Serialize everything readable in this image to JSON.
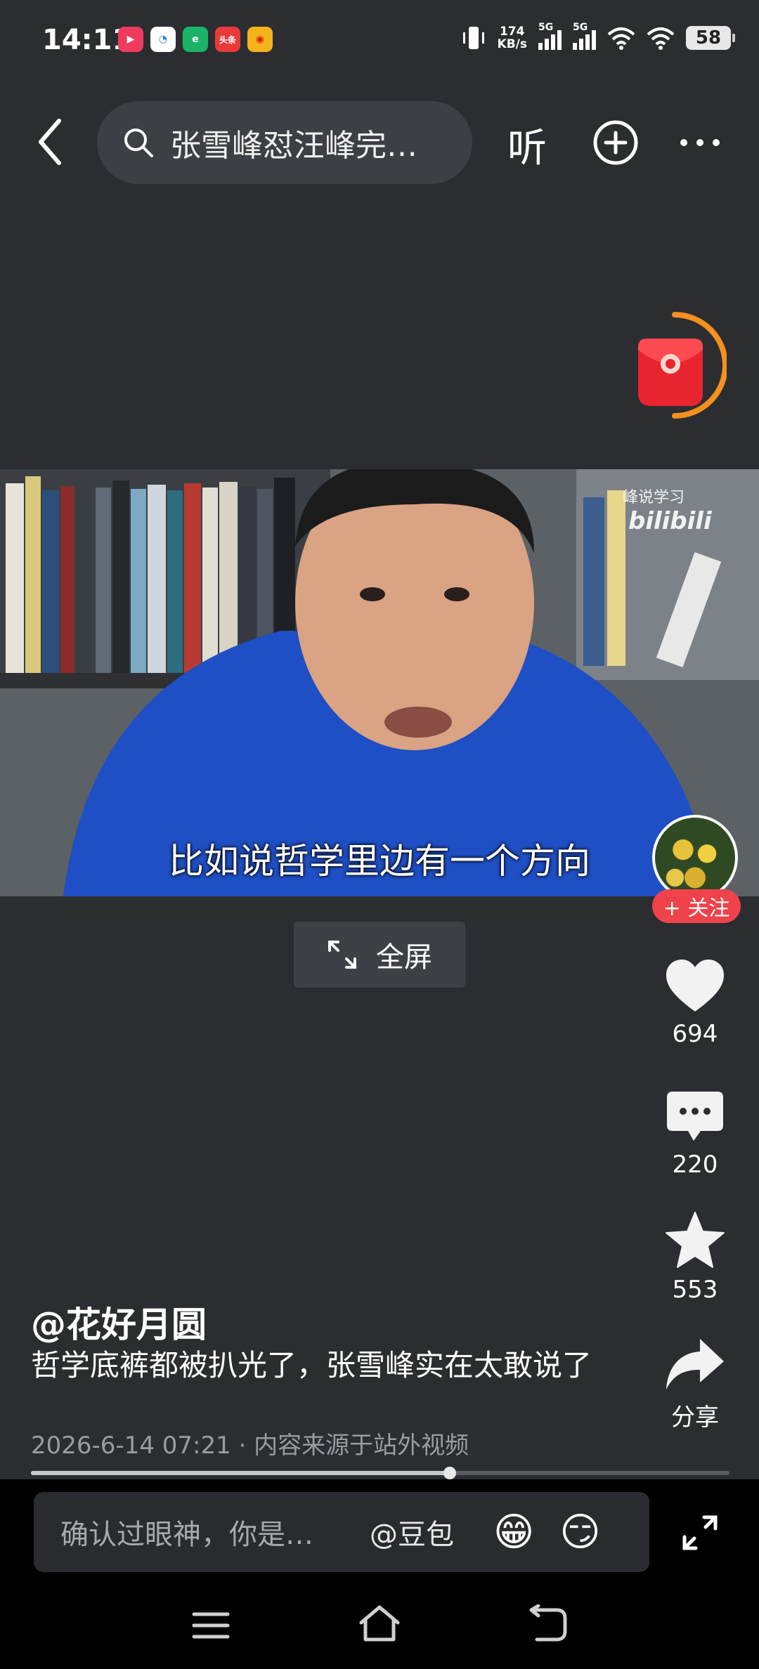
{
  "status_bar": {
    "time": "14:11",
    "net_speed_value": "174",
    "net_speed_unit": "KB/s",
    "signal1_label": "5G",
    "signal2_label": "5G",
    "battery": "58",
    "app_icons": [
      "video-app-icon",
      "browser-icon",
      "edge-icon",
      "toutiao-icon",
      "weibo-icon"
    ],
    "toutiao_label": "头条"
  },
  "top_nav": {
    "search_text": "张雪峰怼汪峰完…",
    "listen_label": "听"
  },
  "video": {
    "subtitle": "比如说哲学里边有一个方向",
    "watermark_text": "峰说学习",
    "watermark_brand": "bilibili"
  },
  "fullscreen": {
    "label": "全屏"
  },
  "side_rail": {
    "follow_label": "+ 关注",
    "likes": "694",
    "comments": "220",
    "favorites": "553",
    "share_label": "分享"
  },
  "post": {
    "author": "@花好月圆",
    "description": "哲学底裤都被扒光了，张雪峰实在太敢说了",
    "meta": "2026-6-14 07:21 · 内容来源于站外视频"
  },
  "progress": {
    "fraction": 0.6
  },
  "comment_bar": {
    "placeholder": "确认过眼神，你是…",
    "mention": "@豆包",
    "emoji1": "😁",
    "emoji2": "😏"
  },
  "colors": {
    "background": "#2b2d31",
    "accent_red": "#f0424a",
    "envelope_ring": "#f5901e"
  }
}
